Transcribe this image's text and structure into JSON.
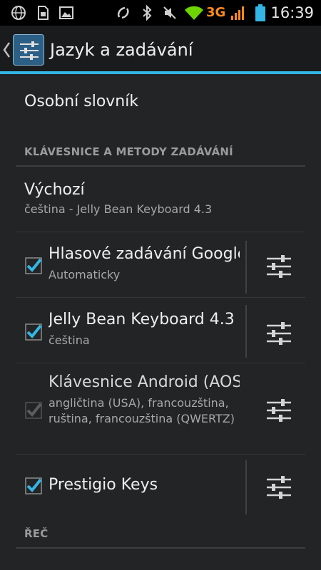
{
  "status_bar": {
    "time": "16:39",
    "network": "3G",
    "icons": [
      "browser-icon",
      "sim-icon",
      "image-icon",
      "nfc-icon",
      "bluetooth-icon",
      "mute-icon",
      "wifi-icon",
      "signal-icon",
      "battery-icon"
    ]
  },
  "action_bar": {
    "title": "Jazyk a zadávání",
    "icon": "settings-sliders-icon"
  },
  "personal_dictionary": {
    "title": "Osobní slovník"
  },
  "section_keyboards": {
    "header": "KLÁVESNICE A METODY ZADÁVÁNÍ"
  },
  "default_input": {
    "title": "Výchozí",
    "summary": "čeština - Jelly Bean Keyboard 4.3"
  },
  "input_methods": [
    {
      "title": "Hlasové zadávání Google",
      "summary": "Automaticky",
      "checked": true,
      "enabled": true
    },
    {
      "title": "Jelly Bean Keyboard 4.3",
      "summary": "čeština",
      "checked": true,
      "enabled": true
    },
    {
      "title": "Klávesnice Android (AOSP)",
      "summary": "angličtina (USA), francouzština, ruština, francouzština (QWERTZ)",
      "checked": true,
      "enabled": false
    },
    {
      "title": "Prestigio Keys",
      "summary": "",
      "checked": true,
      "enabled": true
    }
  ],
  "section_speech": {
    "header": "ŘEČ"
  },
  "colors": {
    "accent": "#33b5e5",
    "background": "#222426",
    "status_bar": "#000000",
    "network_label": "#ff8a1c"
  }
}
